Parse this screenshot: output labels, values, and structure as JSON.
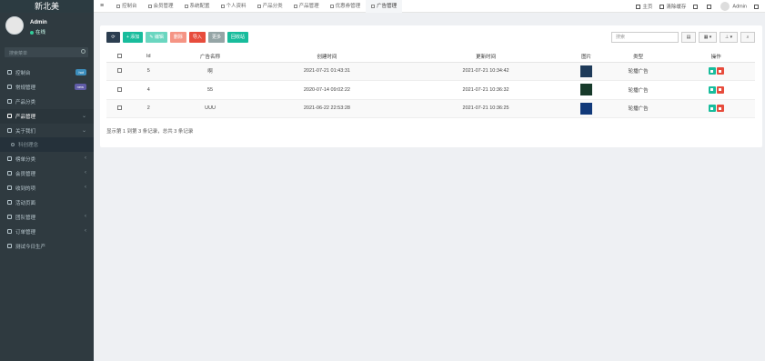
{
  "app": {
    "brand": "新北美"
  },
  "user": {
    "name": "Admin",
    "status": "在线"
  },
  "sidebar_search": {
    "placeholder": "搜索菜单"
  },
  "sidebar": {
    "items": [
      {
        "label": "控制台",
        "icon": "dashboard-icon",
        "badge": "hot",
        "badge_color": "#3c8dbc"
      },
      {
        "label": "常规管理",
        "icon": "cogs-icon",
        "badge": "new",
        "badge_color": "#605ca8"
      },
      {
        "label": "产品分类",
        "icon": "tags-icon"
      },
      {
        "label": "产品管理",
        "icon": "diamond-icon",
        "caret": "⌄",
        "active": true
      },
      {
        "label": "关于我们",
        "icon": "info-icon",
        "caret": "⌄"
      },
      {
        "label": "科创理念",
        "icon": "circle-icon",
        "sub": true
      },
      {
        "label": "榜单分类",
        "icon": "list-icon",
        "caret": "‹"
      },
      {
        "label": "会员管理",
        "icon": "users-icon",
        "caret": "‹"
      },
      {
        "label": "收到的项",
        "icon": "inbox-icon",
        "caret": "‹"
      },
      {
        "label": "活动页面",
        "icon": "page-icon"
      },
      {
        "label": "团队管理",
        "icon": "team-icon",
        "caret": "‹"
      },
      {
        "label": "订单管理",
        "icon": "order-icon",
        "caret": "‹"
      },
      {
        "label": "测试今日生产",
        "icon": "circle-icon"
      }
    ]
  },
  "topbar": {
    "menu_icon": "≡",
    "tabs": [
      {
        "label": "控制台"
      },
      {
        "label": "会员管理"
      },
      {
        "label": "系统配置"
      },
      {
        "label": "个人资料"
      },
      {
        "label": "产品分类"
      },
      {
        "label": "产品管理"
      },
      {
        "label": "优惠券管理"
      },
      {
        "label": "广告管理",
        "active": true
      }
    ],
    "home_label": "主页",
    "clear_cache_label": "清除缓存",
    "user_label": "Admin"
  },
  "toolbar": {
    "refresh_label": "",
    "add_label": "+ 添加",
    "edit_label": "✎ 编辑",
    "delete_label": "删除",
    "import_label": "导入",
    "more_label": "更多",
    "recycle_label": "回收站",
    "search_placeholder": "搜索"
  },
  "table": {
    "columns": [
      "",
      "Id",
      "广告名称",
      "创建时间",
      "更新时间",
      "图片",
      "类型",
      "操作"
    ],
    "rows": [
      {
        "id": "5",
        "name": "啊",
        "created": "2021-07-21 01:43:31",
        "updated": "2021-07-21 10:34:42",
        "img_color": "#1f3b5a",
        "type": "轮播广告"
      },
      {
        "id": "4",
        "name": "55",
        "created": "2020-07-14 09:02:22",
        "updated": "2021-07-21 10:36:32",
        "img_color": "#173a2a",
        "type": "轮播广告"
      },
      {
        "id": "2",
        "name": "UUU",
        "created": "2021-06-22 22:53:28",
        "updated": "2021-07-21 10:36:25",
        "img_color": "#123a7a",
        "type": "轮播广告"
      }
    ]
  },
  "pagination": {
    "summary": "显示第 1 到第 3 条记录，总共 3 条记录"
  }
}
